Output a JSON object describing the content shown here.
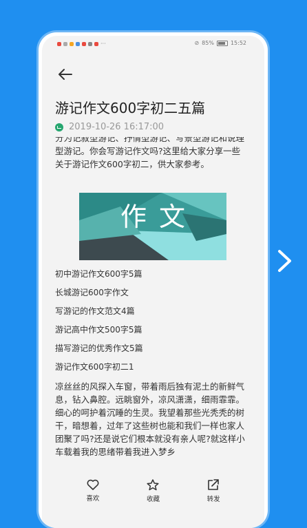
{
  "status_bar": {
    "battery": "85%",
    "time": "15:52"
  },
  "article": {
    "title": "游记作文600字初二五篇",
    "date": "2019-10-26 16:17:00",
    "intro": "分为记叙型游记、抒情型游记、写景型游记和说理型游记。你会写游记作文吗?这里给大家分享一些关于游记作文600字初二，供大家参考。",
    "banner_text": "作文",
    "links": [
      "初中游记作文600字5篇",
      "长城游记600字作文",
      "写游记的作文范文4篇",
      "游记高中作文500字5篇",
      "描写游记的优秀作文5篇",
      "游记作文600字初二1"
    ],
    "paragraph": "凉丝丝的风探入车窗，带着雨后独有泥土的新鲜气息，钻入鼻腔。远眺窗外，凉风潇潇，细雨霏霏。细心的呵护着沉睡的生灵。我望着那些光秃秃的树干，暗想着，过年了这些树也能和我们一样也家人团聚了吗?还是说它们根本就没有亲人呢?就这样小车载着我的思绪带着我进入梦乡"
  },
  "bottom_bar": {
    "like_label": "喜欢",
    "favorite_label": "收藏",
    "share_label": "转发"
  },
  "colors": {
    "background": "#1f8ff0",
    "accent": "#26a66f"
  }
}
